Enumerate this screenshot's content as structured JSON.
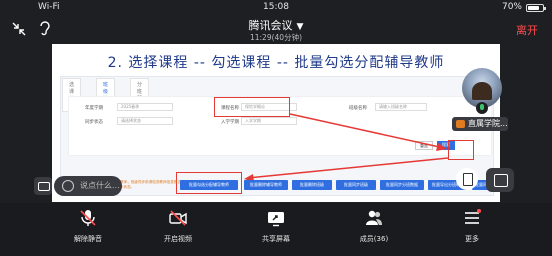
{
  "status": {
    "network": "Wi-Fi",
    "time": "15:08",
    "battery": "70%"
  },
  "meeting": {
    "title": "腾讯会议",
    "duration": "11:29(40分钟)",
    "leave_label": "离开"
  },
  "slide": {
    "heading": "2. 选择课程 -- 勾选课程 -- 批量勾选分配辅导教师",
    "tabs": [
      "选课分组",
      "班级管理",
      "分班明细"
    ],
    "fields": {
      "year_label": "年度学期",
      "year_value": "2025春季",
      "course_label": "课程名称",
      "course_value": "保险学概论",
      "class_label": "班级名称",
      "class_value": "请输入班级名称",
      "sync_label": "同步状态",
      "sync_value": "请选择状态",
      "entry_label": "入学学期",
      "entry_value": "入学学期"
    },
    "reset_label": "重置",
    "search_label": "搜索",
    "note": "注：勾选班级后点击批量分配辅导教师；班级同步前请检查教师信息是否完整，批量同步后可在列表中查看同步状态。",
    "actions": [
      "批量勾选分配辅导教师",
      "批量删除辅导教师",
      "批量删除班级",
      "批量同步班级",
      "批量同步分班数据",
      "批量导出分班明细",
      "批量同步"
    ]
  },
  "participant": {
    "name": "直属学院..."
  },
  "say_placeholder": "说点什么...",
  "toolbar": [
    {
      "label": "解除静音",
      "icon": "mic-muted-icon"
    },
    {
      "label": "开启视频",
      "icon": "video-off-icon"
    },
    {
      "label": "共享屏幕",
      "icon": "share-screen-icon"
    },
    {
      "label": "成员(36)",
      "icon": "members-icon"
    },
    {
      "label": "更多",
      "icon": "more-icon"
    }
  ],
  "colors": {
    "accent": "#2f6ee0",
    "leave": "#ff4d4f",
    "highlight": "#e53935"
  }
}
